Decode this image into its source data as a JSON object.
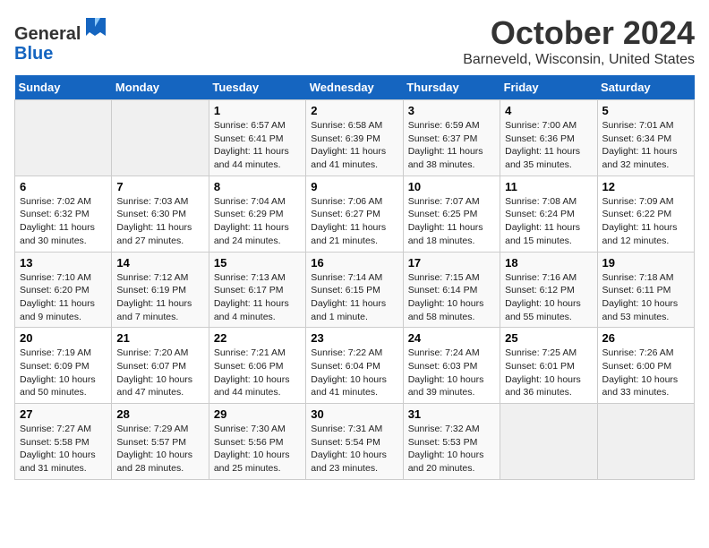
{
  "header": {
    "logo_line1": "General",
    "logo_line2": "Blue",
    "month": "October 2024",
    "location": "Barneveld, Wisconsin, United States"
  },
  "weekdays": [
    "Sunday",
    "Monday",
    "Tuesday",
    "Wednesday",
    "Thursday",
    "Friday",
    "Saturday"
  ],
  "weeks": [
    [
      {
        "num": "",
        "info": ""
      },
      {
        "num": "",
        "info": ""
      },
      {
        "num": "1",
        "info": "Sunrise: 6:57 AM\nSunset: 6:41 PM\nDaylight: 11 hours and 44 minutes."
      },
      {
        "num": "2",
        "info": "Sunrise: 6:58 AM\nSunset: 6:39 PM\nDaylight: 11 hours and 41 minutes."
      },
      {
        "num": "3",
        "info": "Sunrise: 6:59 AM\nSunset: 6:37 PM\nDaylight: 11 hours and 38 minutes."
      },
      {
        "num": "4",
        "info": "Sunrise: 7:00 AM\nSunset: 6:36 PM\nDaylight: 11 hours and 35 minutes."
      },
      {
        "num": "5",
        "info": "Sunrise: 7:01 AM\nSunset: 6:34 PM\nDaylight: 11 hours and 32 minutes."
      }
    ],
    [
      {
        "num": "6",
        "info": "Sunrise: 7:02 AM\nSunset: 6:32 PM\nDaylight: 11 hours and 30 minutes."
      },
      {
        "num": "7",
        "info": "Sunrise: 7:03 AM\nSunset: 6:30 PM\nDaylight: 11 hours and 27 minutes."
      },
      {
        "num": "8",
        "info": "Sunrise: 7:04 AM\nSunset: 6:29 PM\nDaylight: 11 hours and 24 minutes."
      },
      {
        "num": "9",
        "info": "Sunrise: 7:06 AM\nSunset: 6:27 PM\nDaylight: 11 hours and 21 minutes."
      },
      {
        "num": "10",
        "info": "Sunrise: 7:07 AM\nSunset: 6:25 PM\nDaylight: 11 hours and 18 minutes."
      },
      {
        "num": "11",
        "info": "Sunrise: 7:08 AM\nSunset: 6:24 PM\nDaylight: 11 hours and 15 minutes."
      },
      {
        "num": "12",
        "info": "Sunrise: 7:09 AM\nSunset: 6:22 PM\nDaylight: 11 hours and 12 minutes."
      }
    ],
    [
      {
        "num": "13",
        "info": "Sunrise: 7:10 AM\nSunset: 6:20 PM\nDaylight: 11 hours and 9 minutes."
      },
      {
        "num": "14",
        "info": "Sunrise: 7:12 AM\nSunset: 6:19 PM\nDaylight: 11 hours and 7 minutes."
      },
      {
        "num": "15",
        "info": "Sunrise: 7:13 AM\nSunset: 6:17 PM\nDaylight: 11 hours and 4 minutes."
      },
      {
        "num": "16",
        "info": "Sunrise: 7:14 AM\nSunset: 6:15 PM\nDaylight: 11 hours and 1 minute."
      },
      {
        "num": "17",
        "info": "Sunrise: 7:15 AM\nSunset: 6:14 PM\nDaylight: 10 hours and 58 minutes."
      },
      {
        "num": "18",
        "info": "Sunrise: 7:16 AM\nSunset: 6:12 PM\nDaylight: 10 hours and 55 minutes."
      },
      {
        "num": "19",
        "info": "Sunrise: 7:18 AM\nSunset: 6:11 PM\nDaylight: 10 hours and 53 minutes."
      }
    ],
    [
      {
        "num": "20",
        "info": "Sunrise: 7:19 AM\nSunset: 6:09 PM\nDaylight: 10 hours and 50 minutes."
      },
      {
        "num": "21",
        "info": "Sunrise: 7:20 AM\nSunset: 6:07 PM\nDaylight: 10 hours and 47 minutes."
      },
      {
        "num": "22",
        "info": "Sunrise: 7:21 AM\nSunset: 6:06 PM\nDaylight: 10 hours and 44 minutes."
      },
      {
        "num": "23",
        "info": "Sunrise: 7:22 AM\nSunset: 6:04 PM\nDaylight: 10 hours and 41 minutes."
      },
      {
        "num": "24",
        "info": "Sunrise: 7:24 AM\nSunset: 6:03 PM\nDaylight: 10 hours and 39 minutes."
      },
      {
        "num": "25",
        "info": "Sunrise: 7:25 AM\nSunset: 6:01 PM\nDaylight: 10 hours and 36 minutes."
      },
      {
        "num": "26",
        "info": "Sunrise: 7:26 AM\nSunset: 6:00 PM\nDaylight: 10 hours and 33 minutes."
      }
    ],
    [
      {
        "num": "27",
        "info": "Sunrise: 7:27 AM\nSunset: 5:58 PM\nDaylight: 10 hours and 31 minutes."
      },
      {
        "num": "28",
        "info": "Sunrise: 7:29 AM\nSunset: 5:57 PM\nDaylight: 10 hours and 28 minutes."
      },
      {
        "num": "29",
        "info": "Sunrise: 7:30 AM\nSunset: 5:56 PM\nDaylight: 10 hours and 25 minutes."
      },
      {
        "num": "30",
        "info": "Sunrise: 7:31 AM\nSunset: 5:54 PM\nDaylight: 10 hours and 23 minutes."
      },
      {
        "num": "31",
        "info": "Sunrise: 7:32 AM\nSunset: 5:53 PM\nDaylight: 10 hours and 20 minutes."
      },
      {
        "num": "",
        "info": ""
      },
      {
        "num": "",
        "info": ""
      }
    ]
  ]
}
